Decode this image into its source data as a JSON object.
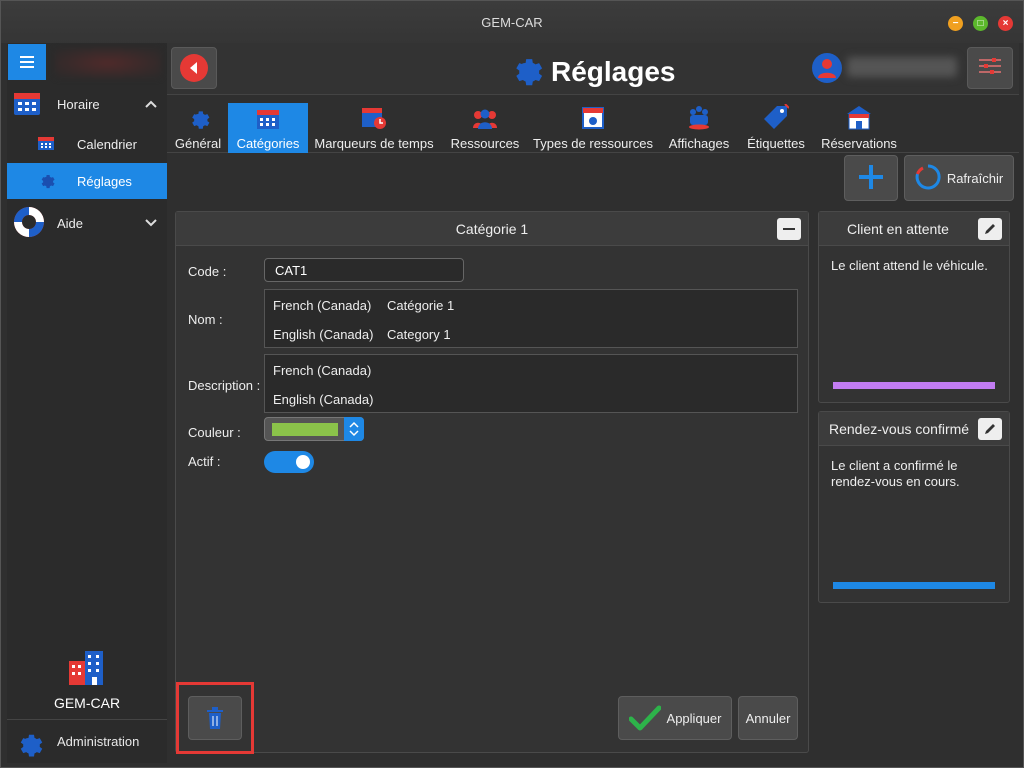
{
  "window": {
    "title": "GEM-CAR",
    "controls": {
      "minimize": "−",
      "maximize": "□",
      "close": "×"
    }
  },
  "sidebar": {
    "sections": [
      {
        "label": "Horaire",
        "icon": "calendar-grid-icon",
        "expanded": true
      },
      {
        "label": "Aide",
        "icon": "lifebuoy-icon",
        "expanded": false
      }
    ],
    "sub_items": [
      {
        "label": "Calendrier",
        "icon": "calendar-icon",
        "active": false
      },
      {
        "label": "Réglages",
        "icon": "gear-icon",
        "active": true
      }
    ],
    "footer_name": "GEM-CAR",
    "admin_label": "Administration"
  },
  "header": {
    "title": "Réglages"
  },
  "tabs": [
    {
      "label": "Général",
      "icon": "gear-icon"
    },
    {
      "label": "Catégories",
      "icon": "calendar-grid-icon",
      "active": true
    },
    {
      "label": "Marqueurs de temps",
      "icon": "calendar-clock-icon"
    },
    {
      "label": "Ressources",
      "icon": "people-icon"
    },
    {
      "label": "Types de ressources",
      "icon": "id-card-icon"
    },
    {
      "label": "Affichages",
      "icon": "display-people-icon"
    },
    {
      "label": "Étiquettes",
      "icon": "tag-icon"
    },
    {
      "label": "Réservations",
      "icon": "reservation-icon"
    }
  ],
  "toolbar": {
    "refresh_label": "Rafraîchir"
  },
  "category_card": {
    "title": "Catégorie 1",
    "code_label": "Code :",
    "code_value": "CAT1",
    "name_label": "Nom :",
    "names": [
      {
        "lang": "French (Canada)",
        "value": "Catégorie 1"
      },
      {
        "lang": "English (Canada)",
        "value": "Category 1"
      }
    ],
    "description_label": "Description :",
    "descriptions": [
      {
        "lang": "French (Canada)",
        "value": ""
      },
      {
        "lang": "English (Canada)",
        "value": ""
      }
    ],
    "color_label": "Couleur :",
    "color_value": "#8bc34a",
    "active_label": "Actif :",
    "active": true,
    "apply_label": "Appliquer",
    "cancel_label": "Annuler"
  },
  "markers": [
    {
      "title": "Client en attente",
      "text": "Le client attend le véhicule.",
      "color": "#c27cf2"
    },
    {
      "title": "Rendez-vous confirmé",
      "text": "Le client a confirmé le rendez-vous en cours.",
      "color": "#1e88e5"
    }
  ]
}
